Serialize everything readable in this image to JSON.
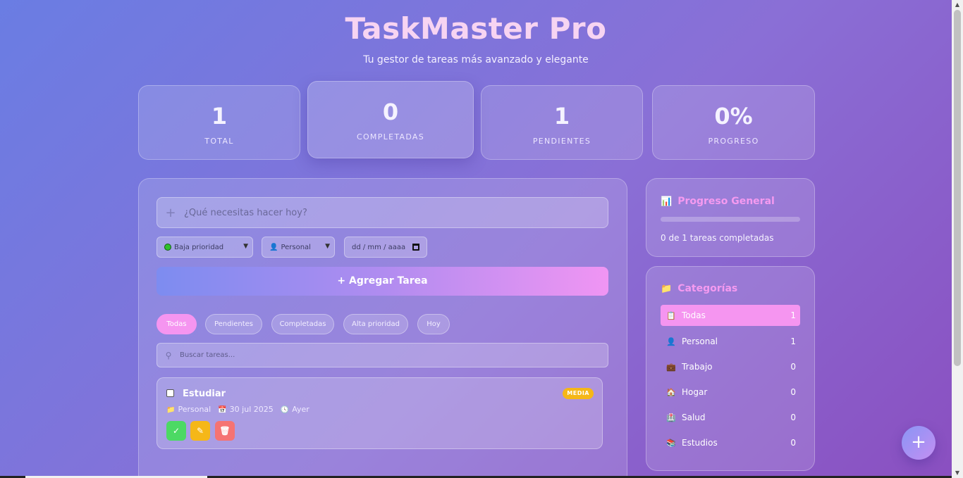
{
  "header": {
    "title": "TaskMaster Pro",
    "subtitle": "Tu gestor de tareas más avanzado y elegante"
  },
  "stats": [
    {
      "value": "1",
      "label": "TOTAL"
    },
    {
      "value": "0",
      "label": "COMPLETADAS"
    },
    {
      "value": "1",
      "label": "PENDIENTES"
    },
    {
      "value": "0%",
      "label": "PROGRESO"
    }
  ],
  "form": {
    "task_placeholder": "¿Qué necesitas hacer hoy?",
    "priority_value": "Baja prioridad",
    "category_value": "Personal",
    "date_placeholder": "dd / mm / aaaa",
    "add_label": "Agregar Tarea"
  },
  "filters": [
    "Todas",
    "Pendientes",
    "Completadas",
    "Alta prioridad",
    "Hoy"
  ],
  "active_filter": "Todas",
  "search": {
    "placeholder": "Buscar tareas..."
  },
  "tasks": [
    {
      "name": "Estudiar",
      "priority_badge": "MEDIA",
      "category": "Personal",
      "date": "30 jul 2025",
      "due": "Ayer",
      "completed": false
    }
  ],
  "progress_panel": {
    "title": "Progreso General",
    "icon": "bar-chart-icon",
    "text": "0 de 1 tareas completadas",
    "progress": 0
  },
  "categories_panel": {
    "title": "Categorías",
    "icon": "folder-icon",
    "items": [
      {
        "label": "Todas",
        "count": "1",
        "icon": "clipboard-icon"
      },
      {
        "label": "Personal",
        "count": "1",
        "icon": "person-icon"
      },
      {
        "label": "Trabajo",
        "count": "0",
        "icon": "briefcase-icon"
      },
      {
        "label": "Hogar",
        "count": "0",
        "icon": "house-icon"
      },
      {
        "label": "Salud",
        "count": "0",
        "icon": "hospital-icon"
      },
      {
        "label": "Estudios",
        "count": "0",
        "icon": "books-icon"
      }
    ]
  },
  "colors": {
    "accent_pink": "#f595f0",
    "badge_media": "#f5b718",
    "complete_green": "#4cd964",
    "edit_yellow": "#f5b718",
    "delete_red": "#f57373"
  }
}
